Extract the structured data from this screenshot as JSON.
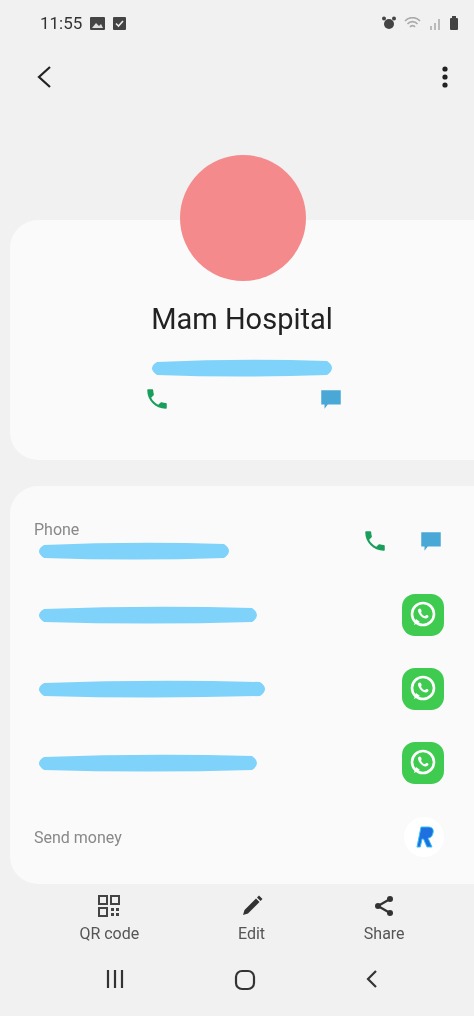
{
  "status_bar": {
    "time": "11:55"
  },
  "contact": {
    "name": "Mam Hospital"
  },
  "details": [
    {
      "kind": "phone",
      "label": "Phone"
    },
    {
      "kind": "whatsapp"
    },
    {
      "kind": "whatsapp"
    },
    {
      "kind": "whatsapp"
    },
    {
      "kind": "money",
      "label": "Send money"
    }
  ],
  "actions": [
    {
      "kind": "qr",
      "label": "QR code"
    },
    {
      "kind": "edit",
      "label": "Edit"
    },
    {
      "kind": "share",
      "label": "Share"
    }
  ]
}
